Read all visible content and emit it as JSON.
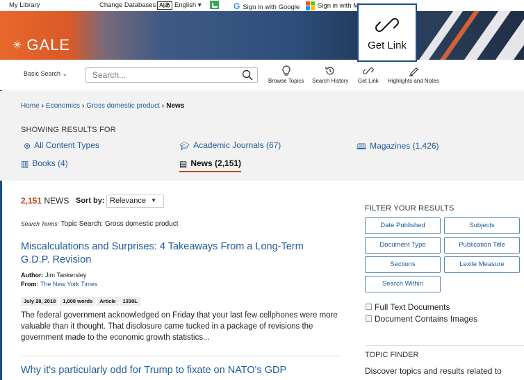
{
  "topbar": {
    "my_library": "My Library",
    "change_databases": "Change Databases",
    "language": "English",
    "sign_in_google": "Sign in with Google",
    "sign_in_microsoft": "Sign in with M"
  },
  "banner": {
    "logo_text": "GALE"
  },
  "toolbar": {
    "search_mode": "Basic Search",
    "search_placeholder": "Search...",
    "tools": {
      "browse_topics": "Browse Topics",
      "search_history": "Search History",
      "get_link": "Get Link",
      "highlights_notes": "Highlights and Notes"
    }
  },
  "callout": {
    "label": "Get Link"
  },
  "breadcrumb": {
    "home": "Home",
    "economics": "Economics",
    "gdp": "Gross domestic product",
    "current": "News"
  },
  "showing": {
    "heading": "SHOWING RESULTS FOR",
    "types": {
      "all": "All Content Types",
      "academic": "Academic Journals (67)",
      "magazines": "Magazines (1,426)",
      "books": "Books (4)",
      "news": "News (2,151)"
    }
  },
  "results": {
    "count": "2,151",
    "count_label": "NEWS",
    "sort_label": "Sort by:",
    "sort_value": "Relevance",
    "search_terms_label": "Search Terms:",
    "search_terms_value": "Topic Search: Gross domestic product",
    "items": [
      {
        "title": "Miscalculations and Surprises: 4 Takeaways From a Long-Term G.D.P. Revision",
        "author_label": "Author:",
        "author": "Jim Tankersley",
        "from_label": "From:",
        "source": "The New York Times",
        "tags": [
          "July 28, 2018",
          "1,008 words",
          "Article",
          "1330L"
        ],
        "snippet": "The federal government acknowledged on Friday that your last few cellphones were more valuable than it thought. That disclosure came tucked in a package of revisions the government made to the economic growth statistics..."
      },
      {
        "title": "Why it's particularly odd for Trump to fixate on NATO's GDP"
      }
    ]
  },
  "filter": {
    "heading": "FILTER YOUR RESULTS",
    "buttons": [
      "Date Published",
      "Subjects",
      "Document Type",
      "Publication Title",
      "Sections",
      "Lexile Measure",
      "Search Within"
    ],
    "checkboxes": [
      "Full Text Documents",
      "Document Contains Images"
    ]
  },
  "topic_finder": {
    "heading": "TOPIC FINDER",
    "text": "Discover topics and results related to"
  },
  "colors": {
    "link": "#1f5a9a",
    "accent": "#c0451d",
    "frame": "#1b4f8a"
  }
}
